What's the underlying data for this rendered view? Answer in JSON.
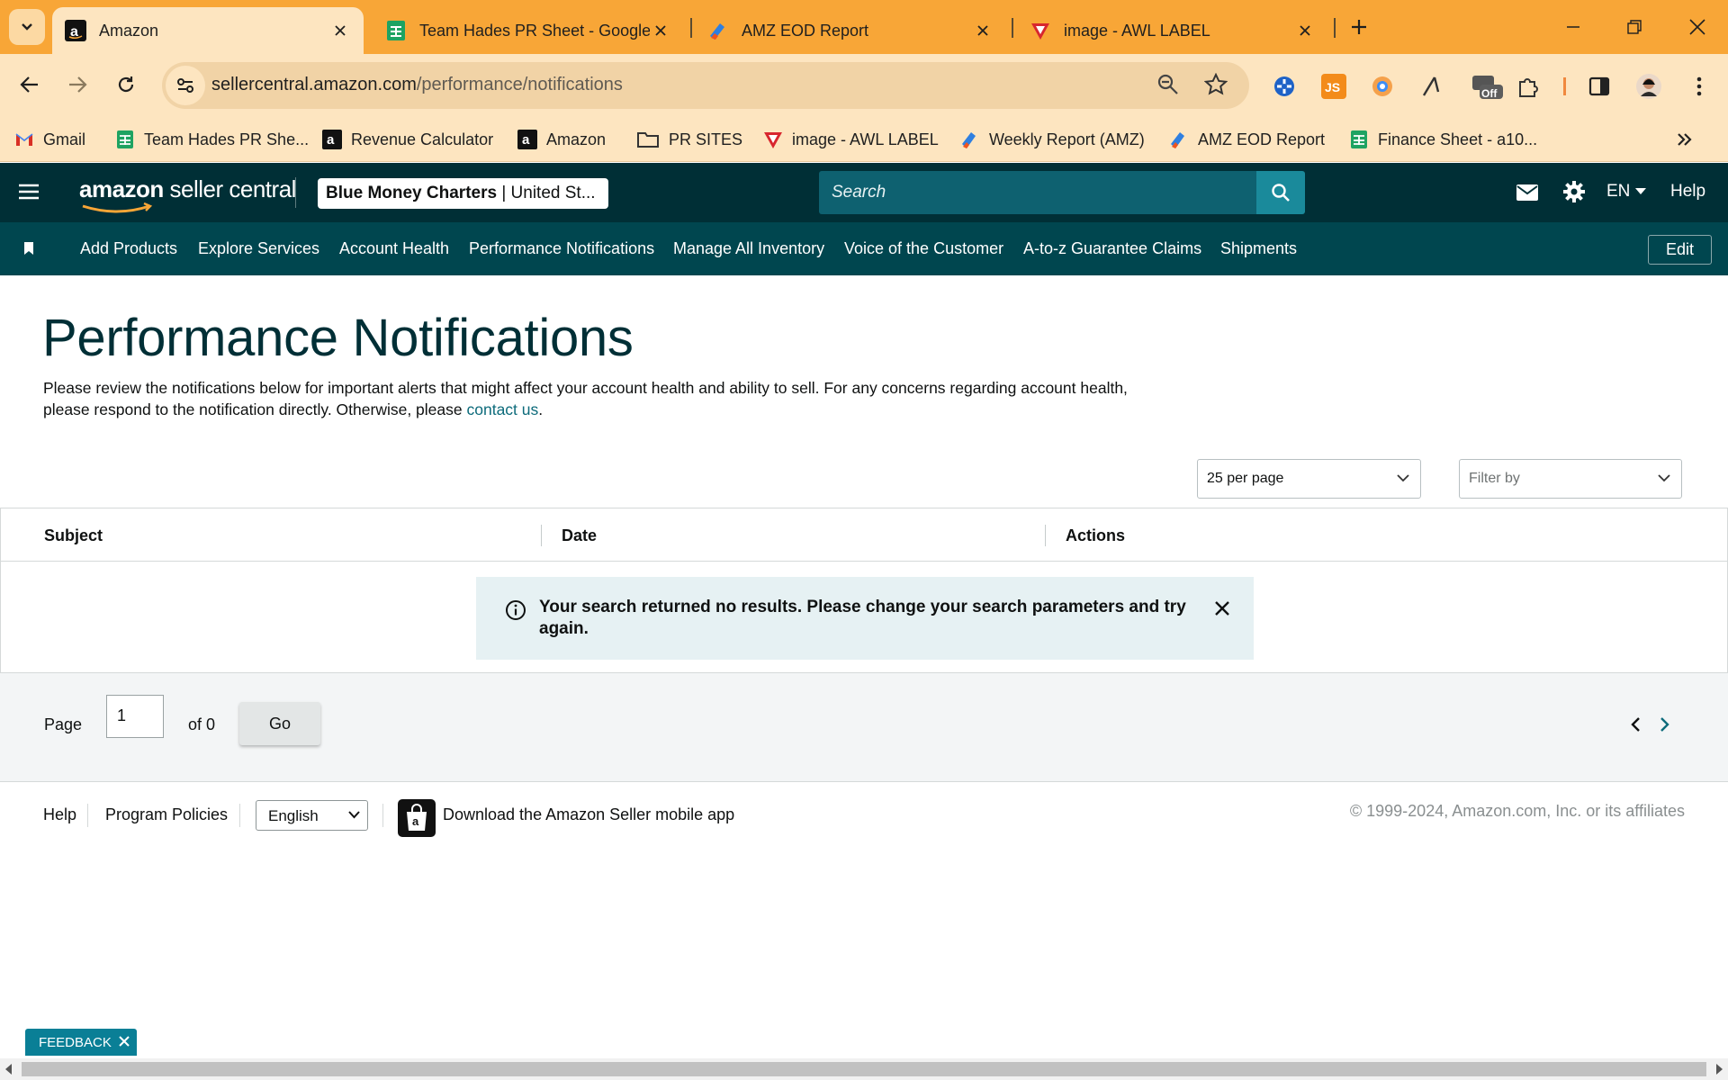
{
  "browser": {
    "tabs": [
      {
        "title": "Amazon",
        "active": true
      },
      {
        "title": "Team Hades PR Sheet - Google Sheets",
        "active": false
      },
      {
        "title": "AMZ EOD Report",
        "active": false
      },
      {
        "title": "image - AWL LABEL",
        "active": false
      }
    ],
    "url": {
      "host": "sellercentral.amazon.com",
      "path": "/performance/notifications"
    },
    "extensions": [
      "crosshair-extension-icon",
      "js-extension-icon",
      "color-picker-extension-icon",
      "arrow-extension-icon",
      "off-extension-icon",
      "puzzle-extensions-icon"
    ],
    "extension_badge": "Off",
    "bookmarks": [
      {
        "label": "Gmail",
        "icon": "gmail-icon"
      },
      {
        "label": "Team Hades PR She...",
        "icon": "sheets-icon"
      },
      {
        "label": "Revenue Calculator",
        "icon": "amazon-icon"
      },
      {
        "label": "Amazon",
        "icon": "amazon-icon"
      },
      {
        "label": "PR SITES",
        "icon": "folder-icon"
      },
      {
        "label": "image - AWL LABEL",
        "icon": "awl-icon"
      },
      {
        "label": "Weekly Report (AMZ)",
        "icon": "report-icon"
      },
      {
        "label": "AMZ EOD Report",
        "icon": "report-icon"
      },
      {
        "label": "Finance Sheet - a10...",
        "icon": "sheets-icon"
      }
    ]
  },
  "header": {
    "logo_brand": "amazon",
    "logo_product": " seller central",
    "account_name": "Blue Money Charters",
    "account_region": " | United St...",
    "search_placeholder": "Search",
    "language": "EN",
    "help": "Help"
  },
  "nav": {
    "items": [
      "Add Products",
      "Explore Services",
      "Account Health",
      "Performance Notifications",
      "Manage All Inventory",
      "Voice of the Customer",
      "A-to-z Guarantee Claims",
      "Shipments"
    ],
    "edit": "Edit"
  },
  "main": {
    "title": "Performance Notifications",
    "intro_text": "Please review the notifications below for important alerts that might affect your account health and ability to sell. For any concerns regarding account health, please respond to the notification directly. Otherwise, please ",
    "intro_link": "contact us",
    "intro_end": ".",
    "per_page": "25 per page",
    "filter_placeholder": "Filter by",
    "columns": [
      "Subject",
      "Date",
      "Actions"
    ],
    "empty_message": "Your search returned no results. Please change your search parameters and try again.",
    "pagination": {
      "page_label": "Page",
      "current_page": "1",
      "of_label": "of 0",
      "go_label": "Go"
    }
  },
  "footer": {
    "help": "Help",
    "program_policies": "Program Policies",
    "language": "English",
    "app_link": "Download the Amazon Seller mobile app",
    "copyright": "© 1999-2024, Amazon.com, Inc. or its affiliates"
  },
  "feedback": {
    "label": "FEEDBACK"
  },
  "colors": {
    "chrome": "#f8a637",
    "header": "#002f36",
    "nav": "#00464f",
    "accent": "#1a8a9b"
  }
}
